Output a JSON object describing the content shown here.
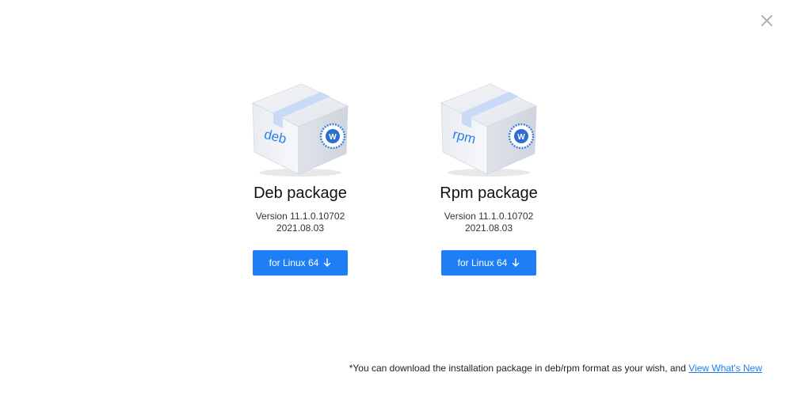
{
  "dialog": {
    "close_icon": "close-icon"
  },
  "packages": [
    {
      "box_label": "deb",
      "title": "Deb package",
      "version": "Version 11.1.0.10702",
      "date": "2021.08.03",
      "button_label": "for Linux 64",
      "button_icon": "download-arrow-icon"
    },
    {
      "box_label": "rpm",
      "title": "Rpm package",
      "version": "Version 11.1.0.10702",
      "date": "2021.08.03",
      "button_label": "for Linux 64",
      "button_icon": "download-arrow-icon"
    }
  ],
  "footer": {
    "note": "*You can download the installation package in deb/rpm format as your wish, and",
    "link_label": "View What's New"
  },
  "colors": {
    "accent": "#1d7ef5",
    "background": "#ffffff",
    "close": "#b0b0b0"
  }
}
